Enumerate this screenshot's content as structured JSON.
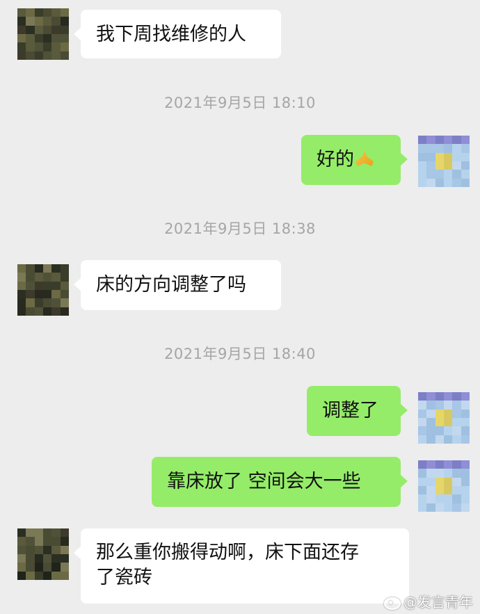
{
  "messages": [
    {
      "side": "left",
      "text": "我下周找维修的人"
    },
    {
      "timestamp": "2021年9月5日 18:10"
    },
    {
      "side": "right",
      "text": "好的",
      "emoji": "folded-hands-icon"
    },
    {
      "timestamp": "2021年9月5日 18:38"
    },
    {
      "side": "left",
      "text": "床的方向调整了吗"
    },
    {
      "timestamp": "2021年9月5日 18:40"
    },
    {
      "side": "right",
      "text": "调整了"
    },
    {
      "side": "right",
      "text": "靠床放了 空间会大一些"
    },
    {
      "side": "left",
      "text_line1": "那么重你搬得动啊，床下面还存",
      "text_line2": "了瓷砖"
    }
  ],
  "watermark": {
    "text": "@发言青年",
    "icon": "weibo-logo-icon"
  },
  "colors": {
    "background": "#ededed",
    "left_bubble": "#ffffff",
    "right_bubble": "#95ec69",
    "timestamp": "#a5a5a5"
  }
}
